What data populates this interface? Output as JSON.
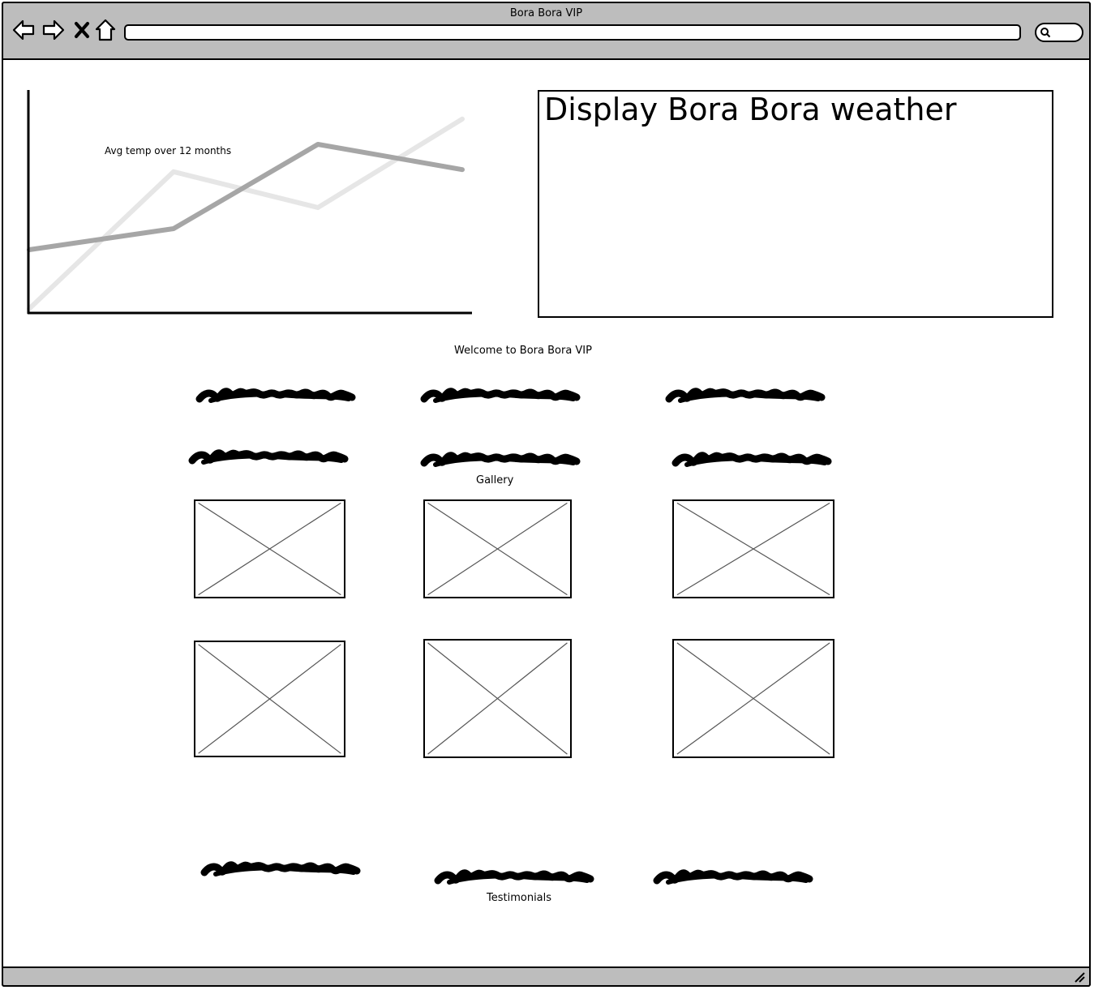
{
  "window": {
    "title": "Bora Bora VIP",
    "url": "",
    "icons": [
      "back-arrow-icon",
      "forward-arrow-icon",
      "stop-icon",
      "home-icon",
      "search-icon",
      "resize-grip-icon"
    ]
  },
  "chart_data": {
    "type": "line",
    "title": "Avg temp over 12 months",
    "xlabel": "",
    "ylabel": "",
    "x": [
      0,
      1,
      2,
      3
    ],
    "ylim": [
      0,
      100
    ],
    "grid": false,
    "series": [
      {
        "values": [
          2,
          67,
          50,
          92
        ],
        "color": "#e6e6e6"
      },
      {
        "values": [
          30,
          40,
          80,
          68
        ],
        "color": "#a6a6a6"
      }
    ]
  },
  "weather": {
    "heading": "Display Bora Bora weather"
  },
  "main": {
    "welcome": "Welcome to Bora Bora VIP",
    "gallery_label": "Gallery",
    "testimonials_label": "Testimonials",
    "placeholder_text_rows": 2,
    "image_placeholders": 6
  },
  "colors": {
    "chrome": "#bdbdbd",
    "border": "#000000",
    "placeholder_cross": "#555555"
  }
}
